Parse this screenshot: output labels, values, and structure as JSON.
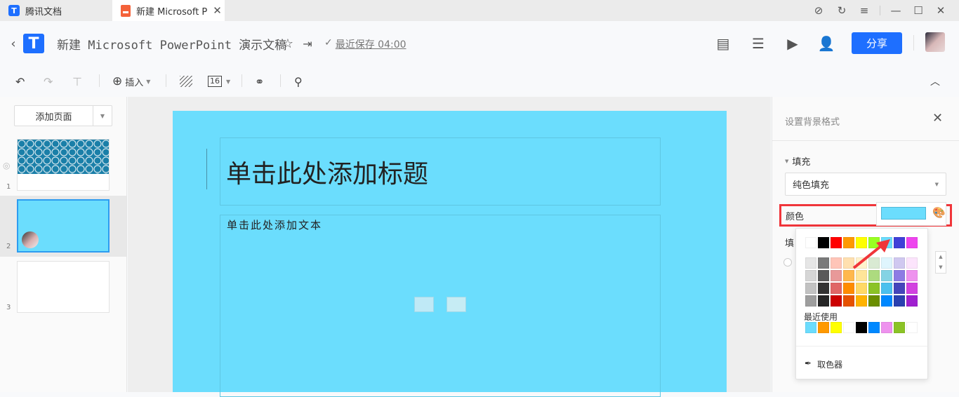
{
  "tabs": [
    {
      "label": "腾讯文档"
    },
    {
      "label": "新建 Microsoft P"
    }
  ],
  "header": {
    "title": "新建 Microsoft PowerPoint 演示文稿",
    "save_status": "最近保存 04:00",
    "share": "分享"
  },
  "toolbar": {
    "insert": "插入",
    "font_size": "16"
  },
  "sidebar": {
    "add_page": "添加页面",
    "slides": [
      {
        "num": "1"
      },
      {
        "num": "2"
      },
      {
        "num": "3"
      }
    ]
  },
  "slide": {
    "title_placeholder": "单击此处添加标题",
    "text_placeholder": "单击此处添加文本"
  },
  "panel": {
    "title": "设置背景格式",
    "fill_section": "填充",
    "fill_type": "纯色填充",
    "color_label": "颜色",
    "fill_label_partial": "填",
    "current_color": "#6bddfd"
  },
  "picker": {
    "theme_row": [
      "#ffffff",
      "#000000",
      "#ff0000",
      "#ff9900",
      "#ffff00",
      "#99ff22",
      "#6bdcfd",
      "#4040d8",
      "#ee44ee"
    ],
    "shades": [
      [
        "#e6e6e6",
        "#7a7a7a",
        "#ffc5b8",
        "#ffe0b0",
        "#fff2cc",
        "#d9ead3",
        "#dff5fd",
        "#d0c8f0",
        "#fce4fc"
      ],
      [
        "#d6d6d6",
        "#5a5a5a",
        "#e89999",
        "#ffb84d",
        "#ffe599",
        "#addb7f",
        "#84d3e4",
        "#8e7be4",
        "#ee92ee"
      ],
      [
        "#c2c2c2",
        "#333333",
        "#e06666",
        "#ff8c00",
        "#ffd966",
        "#8bc326",
        "#4cc0ee",
        "#4545bb",
        "#d242e0"
      ],
      [
        "#9e9e9e",
        "#262626",
        "#cc0000",
        "#e65100",
        "#ffb300",
        "#6a8e00",
        "#0088ff",
        "#2a40b0",
        "#a020d0"
      ]
    ],
    "recent_label": "最近使用",
    "recent": [
      "#6bdcfd",
      "#ff9900",
      "#ffff00",
      "#ffffff",
      "#000000",
      "#0088ff",
      "#ee92ee",
      "#8bc326",
      "#ffffff"
    ],
    "eyedropper": "取色器"
  }
}
